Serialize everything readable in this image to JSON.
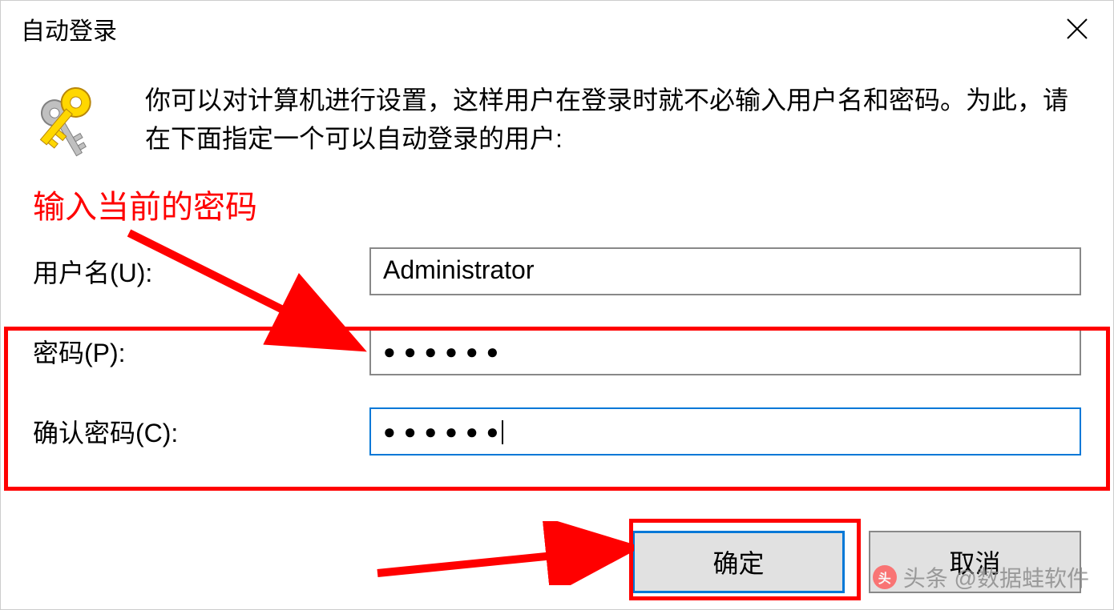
{
  "dialog": {
    "title": "自动登录",
    "description": "你可以对计算机进行设置，这样用户在登录时就不必输入用户名和密码。为此，请在下面指定一个可以自动登录的用户:"
  },
  "annotation": {
    "hint": "输入当前的密码"
  },
  "form": {
    "username": {
      "label": "用户名(U):",
      "value": "Administrator"
    },
    "password": {
      "label": "密码(P):",
      "value": "●●●●●●"
    },
    "confirm": {
      "label": "确认密码(C):",
      "value": "●●●●●●"
    }
  },
  "buttons": {
    "ok": "确定",
    "cancel": "取消"
  },
  "watermark": {
    "text": "头条 @数据蛙软件",
    "icon": "头"
  }
}
